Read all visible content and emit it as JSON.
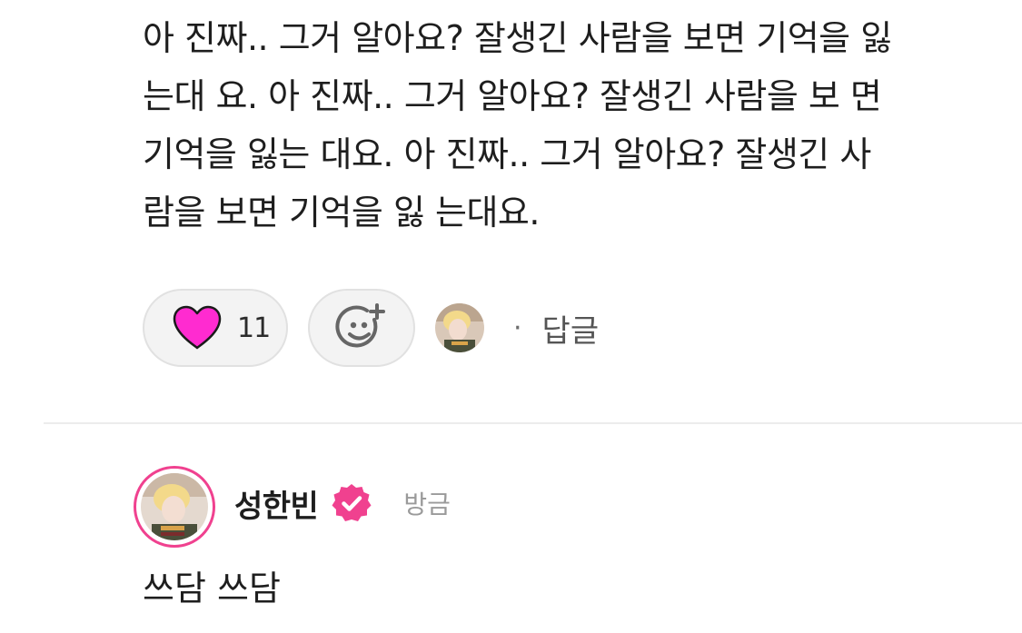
{
  "comment": {
    "lines": [
      "아 진짜.. 그거 알아요? 잘생긴 사람을 보면 기억을 잃",
      "는대 요. 아 진짜.. 그거 알아요? 잘생긴 사람을 보 면",
      "기억을 잃는 대요. 아 진짜.. 그거 알아요? 잘생긴 사",
      "람을 보면 기억을 잃 는대요."
    ],
    "like_count": "11",
    "separator": "·",
    "reply_label": "답글"
  },
  "reply": {
    "author": "성한빈",
    "timestamp": "방금",
    "text": "쓰담 쓰담"
  },
  "colors": {
    "heart": "#ff2bd0",
    "accent": "#f0418f",
    "verified_badge": "#f0418f"
  },
  "icons": {
    "like": "heart-icon",
    "add_reaction": "add-emoji-icon",
    "verified": "verified-badge-icon"
  }
}
